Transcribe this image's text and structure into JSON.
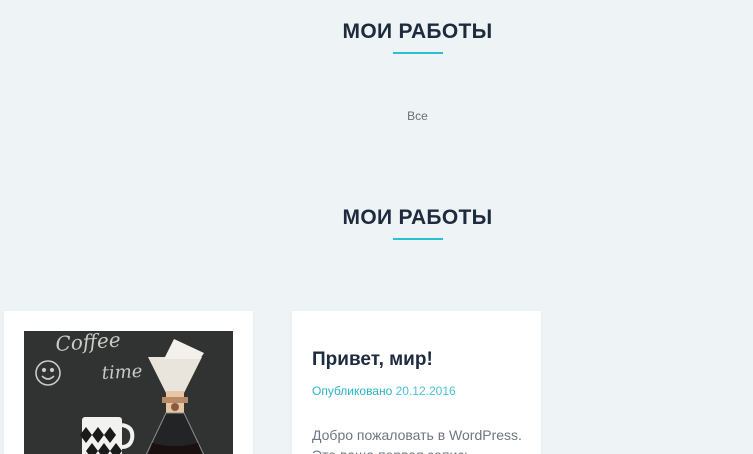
{
  "sections": [
    {
      "title": "МОИ РАБОТЫ"
    },
    {
      "title": "МОИ РАБОТЫ"
    }
  ],
  "filter": {
    "all_label": "Все"
  },
  "thumbnail": {
    "chalk_line_1": "Coffee",
    "chalk_line_2": "time"
  },
  "post": {
    "title": "Привет, мир!",
    "meta_prefix": "Опубликовано",
    "date": "20.12.2016",
    "excerpt_line_1": "Добро пожаловать в WordPress.",
    "excerpt_line_2": "Это ваша первая запись."
  },
  "colors": {
    "background": "#eef3f5",
    "accent": "#2bc0d0",
    "heading": "#1e2a3d"
  }
}
